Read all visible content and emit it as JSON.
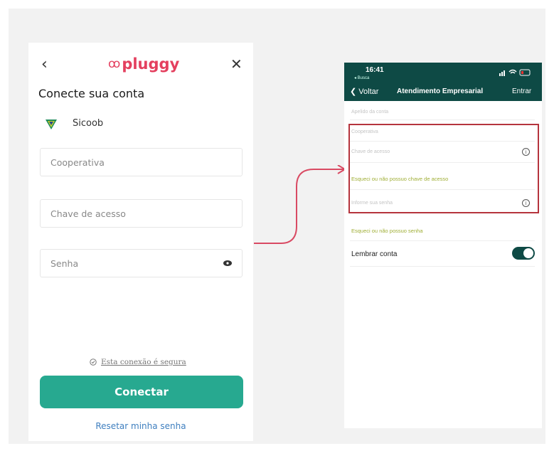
{
  "left_form": {
    "logo_text": "pluggy",
    "title": "Conecte sua conta",
    "bank_name": "Sicoob",
    "fields": {
      "cooperativa_placeholder": "Cooperativa",
      "chave_placeholder": "Chave de acesso",
      "senha_placeholder": "Senha"
    },
    "secure_text": "Esta conexão é segura",
    "connect_label": "Conectar",
    "reset_label": "Resetar minha senha",
    "colors": {
      "brand": "#e4405f",
      "primary": "#27a990",
      "link": "#3f7fbf"
    }
  },
  "phone": {
    "time": "16:41",
    "back_small": "◂ Busca",
    "nav_back": "Voltar",
    "nav_title": "Atendimento Empresarial",
    "nav_enter": "Entrar",
    "account_type": "Apelido da conta",
    "cooperativa": "Cooperativa",
    "chave_placeholder": "Chave de acesso",
    "forgot_chave": "Esqueci ou não possuo chave de acesso",
    "senha_placeholder": "Informe sua senha",
    "forgot_senha": "Esqueci ou não possuo senha",
    "remember_label": "Lembrar conta",
    "colors": {
      "header": "#0e4a45",
      "highlight": "#b5343d",
      "link": "#9fae35"
    }
  }
}
